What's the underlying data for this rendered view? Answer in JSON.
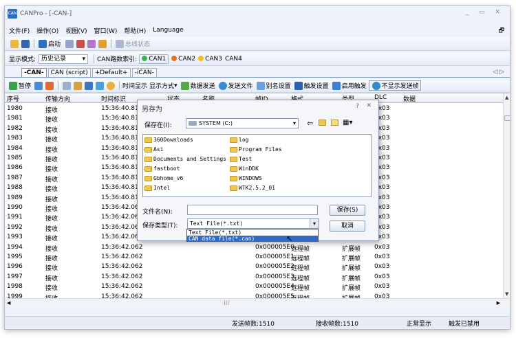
{
  "window": {
    "title": "CANPro - [-CAN-]",
    "controls": "_ ▭ ✕"
  },
  "menu": {
    "items": [
      "文件(F)",
      "操作(O)",
      "视图(V)",
      "窗口(W)",
      "帮助(H)",
      "Language"
    ]
  },
  "toolbar1": {
    "start_label": "启动",
    "bus_status_label": "总线状态"
  },
  "toolbar2": {
    "display_mode_label": "显示模式:",
    "display_mode_value": "历史记录",
    "can_index_label": "CAN路数索引:",
    "channels": [
      "CAN1",
      "CAN2",
      "CAN3",
      "CAN4"
    ],
    "channel_colors": [
      "#3cb44b",
      "#e8742a",
      "#f0c020",
      "#cccccc"
    ]
  },
  "tabs": {
    "items": [
      "-CAN-",
      "CAN (script)",
      "+Default+",
      "-iCAN-"
    ],
    "nav": "◁ ▷"
  },
  "toolbar3": {
    "pause": "暂停",
    "time_display": "时间显示",
    "display_mode": "显示方式",
    "data_send": "数据发送",
    "send_file": "发送文件",
    "alias": "别名设置",
    "trigger_settings": "触发设置",
    "enable_trigger": "启用触发",
    "no_show_sent": "不显示发送帧"
  },
  "grid": {
    "headers": [
      "序号",
      "传输方向",
      "时间标识",
      "状态",
      "名称",
      "帧ID",
      "格式",
      "类型",
      "DLC",
      "数据"
    ],
    "rows": [
      {
        "seq": "1980",
        "dir": "接收",
        "time": "15:36:40.812",
        "id": "",
        "fmt": "",
        "type": "",
        "dlc": "0x03"
      },
      {
        "seq": "1981",
        "dir": "接收",
        "time": "15:36:40.812",
        "id": "",
        "fmt": "",
        "type": "",
        "dlc": "0x03"
      },
      {
        "seq": "1982",
        "dir": "接收",
        "time": "15:36:40.812",
        "id": "",
        "fmt": "",
        "type": "",
        "dlc": "0x03"
      },
      {
        "seq": "1983",
        "dir": "接收",
        "time": "15:36:40.812",
        "id": "",
        "fmt": "",
        "type": "",
        "dlc": "0x03"
      },
      {
        "seq": "1984",
        "dir": "接收",
        "time": "15:36:40.812",
        "id": "",
        "fmt": "",
        "type": "",
        "dlc": "0x03"
      },
      {
        "seq": "1985",
        "dir": "接收",
        "time": "15:36:40.812",
        "id": "",
        "fmt": "",
        "type": "",
        "dlc": "0x03"
      },
      {
        "seq": "1986",
        "dir": "接收",
        "time": "15:36:40.812",
        "id": "",
        "fmt": "",
        "type": "",
        "dlc": "0x03"
      },
      {
        "seq": "1987",
        "dir": "接收",
        "time": "15:36:40.812",
        "id": "",
        "fmt": "",
        "type": "",
        "dlc": "0x03"
      },
      {
        "seq": "1988",
        "dir": "接收",
        "time": "15:36:40.812",
        "id": "",
        "fmt": "",
        "type": "",
        "dlc": "0x03"
      },
      {
        "seq": "1989",
        "dir": "接收",
        "time": "15:36:40.812",
        "id": "",
        "fmt": "",
        "type": "",
        "dlc": "0x03"
      },
      {
        "seq": "1990",
        "dir": "接收",
        "time": "15:36:42.062",
        "id": "",
        "fmt": "",
        "type": "",
        "dlc": "0x03"
      },
      {
        "seq": "1991",
        "dir": "接收",
        "time": "15:36:42.062",
        "id": "",
        "fmt": "",
        "type": "",
        "dlc": "0x03"
      },
      {
        "seq": "1992",
        "dir": "接收",
        "time": "15:36:42.062",
        "id": "",
        "fmt": "",
        "type": "",
        "dlc": "0x03"
      },
      {
        "seq": "1993",
        "dir": "接收",
        "time": "15:36:42.062",
        "id": "",
        "fmt": "",
        "type": "",
        "dlc": "0x03"
      },
      {
        "seq": "1994",
        "dir": "接收",
        "time": "15:36:42.062",
        "id": "0x000005E0",
        "fmt": "远程帧",
        "type": "扩展帧",
        "dlc": "0x03"
      },
      {
        "seq": "1995",
        "dir": "接收",
        "time": "15:36:42.062",
        "id": "0x000005E1",
        "fmt": "远程帧",
        "type": "扩展帧",
        "dlc": "0x03"
      },
      {
        "seq": "1996",
        "dir": "接收",
        "time": "15:36:42.062",
        "id": "0x000005E2",
        "fmt": "远程帧",
        "type": "扩展帧",
        "dlc": "0x03"
      },
      {
        "seq": "1997",
        "dir": "接收",
        "time": "15:36:42.062",
        "id": "0x000005E3",
        "fmt": "远程帧",
        "type": "扩展帧",
        "dlc": "0x03"
      },
      {
        "seq": "1998",
        "dir": "接收",
        "time": "15:36:42.062",
        "id": "0x000005E4",
        "fmt": "远程帧",
        "type": "扩展帧",
        "dlc": "0x03"
      },
      {
        "seq": "1999",
        "dir": "接收",
        "time": "15:36:42.062",
        "id": "0x000005E5",
        "fmt": "远程帧",
        "type": "扩展帧",
        "dlc": "0x03"
      }
    ],
    "hscroll_mid": "III"
  },
  "status": {
    "sent": "发送帧数:1510",
    "recv": "接收帧数:1510",
    "display": "正常显示",
    "trigger": "触发已禁用"
  },
  "dialog": {
    "title": "另存为",
    "help": "?",
    "close": "✕",
    "save_in_label": "保存在(I):",
    "save_in_value": "SYSTEM (C:)",
    "files": [
      "360Downloads",
      "Asi",
      "Documents and Settings",
      "fastboot",
      "Gbhome_v6",
      "Intel",
      "log",
      "Program Files",
      "Test",
      "WinDDK",
      "WINDOWS",
      "WTK2.5.2_01"
    ],
    "filename_label": "文件名(N):",
    "filename_value": "",
    "filetype_label": "保存类型(T):",
    "filetype_value": "Text File(*.txt)",
    "filetype_options": [
      "Text File(*.txt)",
      "CAN data file(*.can)"
    ],
    "save_button": "保存(S)",
    "cancel_button": "取消"
  }
}
